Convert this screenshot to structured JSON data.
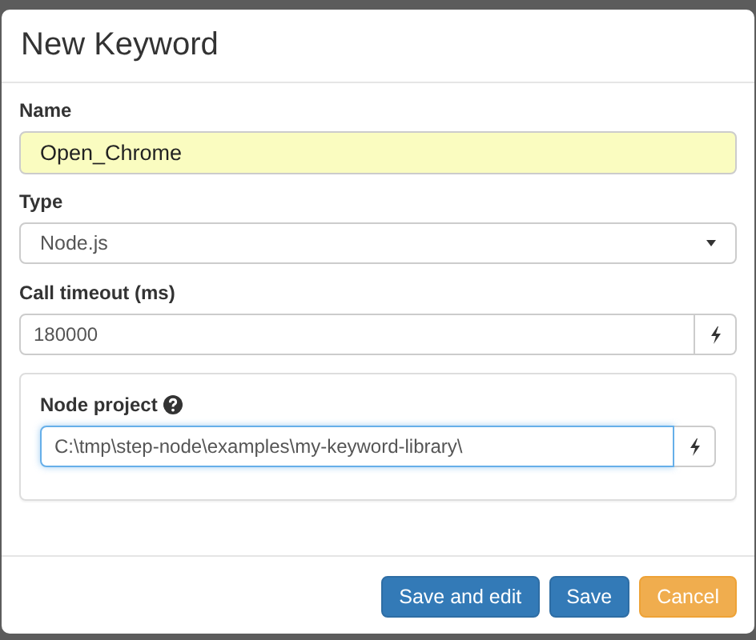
{
  "dialog": {
    "title": "New Keyword"
  },
  "fields": [
    {
      "kind": "text",
      "label": "Name",
      "value": "Open_Chrome",
      "highlighted": true
    },
    {
      "kind": "select",
      "label": "Type",
      "value": "Node.js",
      "highlighted": false
    },
    {
      "kind": "addon",
      "label": "Call timeout (ms)",
      "value": "180000",
      "highlighted": false
    }
  ],
  "panel": {
    "fields": [
      {
        "kind": "addon",
        "label": "Node project",
        "help": true,
        "value": "C:\\tmp\\step-node\\examples\\my-keyword-library\\",
        "focused": true
      }
    ]
  },
  "buttons": [
    {
      "label": "Save and edit",
      "kind": "primary"
    },
    {
      "label": "Save",
      "kind": "primary"
    },
    {
      "label": "Cancel",
      "kind": "warning"
    }
  ]
}
